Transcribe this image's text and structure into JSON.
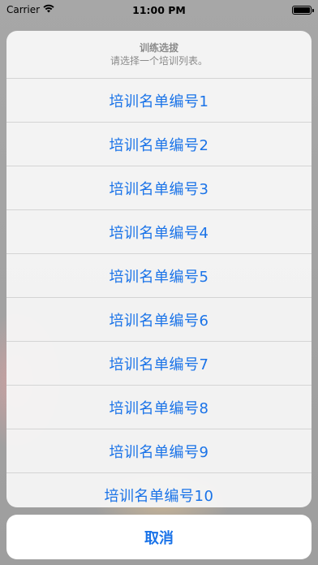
{
  "status_bar": {
    "carrier": "Carrier",
    "time": "11:00 PM",
    "wifi_icon": "wifi-icon",
    "battery_icon": "battery-icon",
    "battery_level": 1.0
  },
  "action_sheet": {
    "title": "训练选拔",
    "message": "请选择一个培训列表。",
    "options": [
      "培训名单编号1",
      "培训名单编号2",
      "培训名单编号3",
      "培训名单编号4",
      "培训名单编号5",
      "培训名单编号6",
      "培训名单编号7",
      "培训名单编号8",
      "培训名单编号9",
      "培训名单编号10"
    ],
    "cancel_label": "取消"
  },
  "colors": {
    "accent": "#1a73e8",
    "secondary_text": "#8a8a8a",
    "sheet_background": "#f6f6f6"
  }
}
